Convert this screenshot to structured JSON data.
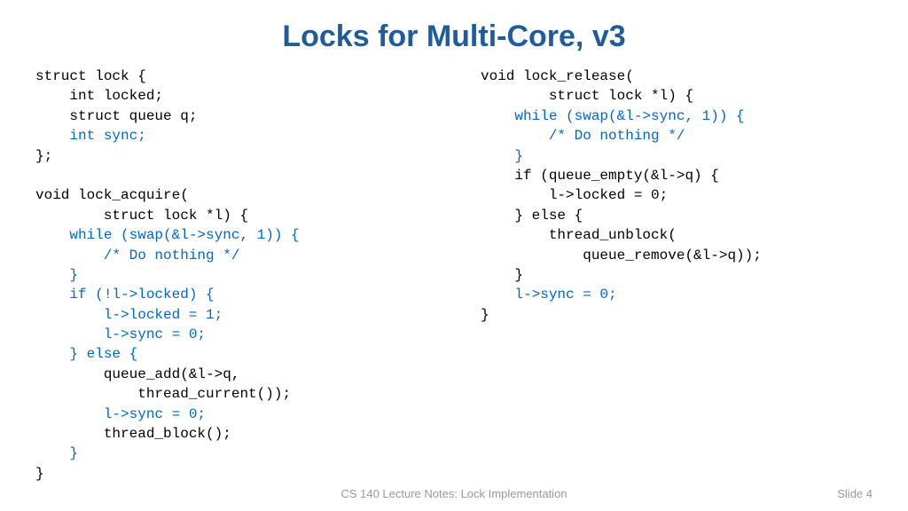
{
  "title": "Locks for Multi-Core, v3",
  "left": {
    "l1": "struct lock {",
    "l2": "    int locked;",
    "l3": "    struct queue q;",
    "l4": "    int sync;",
    "l5": "};",
    "l6": "",
    "l7": "void lock_acquire(",
    "l8": "        struct lock *l) {",
    "l9a": "    ",
    "l9b": "while (swap(&l->sync, 1)) {",
    "l10a": "        ",
    "l10b": "/* Do nothing */",
    "l11a": "    ",
    "l11b": "}",
    "l12a": "    ",
    "l12b": "if (!l->locked) {",
    "l13a": "        ",
    "l13b": "l->locked = 1;",
    "l14a": "        ",
    "l14b": "l->sync = 0;",
    "l15a": "    ",
    "l15b": "} else {",
    "l16": "        queue_add(&l->q,",
    "l17": "            thread_current());",
    "l18a": "        ",
    "l18b": "l->sync = 0;",
    "l19": "        thread_block();",
    "l20a": "    ",
    "l20b": "}",
    "l21": "}"
  },
  "right": {
    "l1": "void lock_release(",
    "l2": "        struct lock *l) {",
    "l3a": "    ",
    "l3b": "while (swap(&l->sync, 1)) {",
    "l4a": "        ",
    "l4b": "/* Do nothing */",
    "l5a": "    ",
    "l5b": "}",
    "l6": "    if (queue_empty(&l->q) {",
    "l7": "        l->locked = 0;",
    "l8": "    } else {",
    "l9": "        thread_unblock(",
    "l10": "            queue_remove(&l->q));",
    "l11": "    }",
    "l12a": "    ",
    "l12b": "l->sync = 0;",
    "l13": "}"
  },
  "footer": {
    "center": "CS 140 Lecture Notes: Lock Implementation",
    "right": "Slide 4"
  }
}
